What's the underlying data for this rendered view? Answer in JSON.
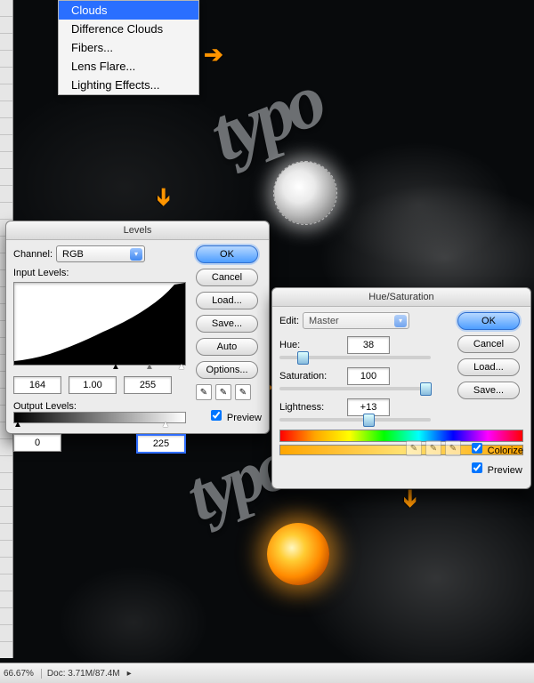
{
  "menu": {
    "items": [
      {
        "label": "Clouds",
        "selected": true
      },
      {
        "label": "Difference Clouds"
      },
      {
        "label": "Fibers..."
      },
      {
        "label": "Lens Flare..."
      },
      {
        "label": "Lighting Effects..."
      }
    ]
  },
  "levels": {
    "title": "Levels",
    "channel_label": "Channel:",
    "channel_value": "RGB",
    "input_label": "Input Levels:",
    "input_black": "164",
    "input_gamma": "1.00",
    "input_white": "255",
    "output_label": "Output Levels:",
    "output_black": "0",
    "output_white": "225",
    "buttons": {
      "ok": "OK",
      "cancel": "Cancel",
      "load": "Load...",
      "save": "Save...",
      "auto": "Auto",
      "options": "Options..."
    },
    "preview_label": "Preview"
  },
  "huesat": {
    "title": "Hue/Saturation",
    "edit_label": "Edit:",
    "edit_value": "Master",
    "hue_label": "Hue:",
    "hue_value": "38",
    "sat_label": "Saturation:",
    "sat_value": "100",
    "light_label": "Lightness:",
    "light_value": "+13",
    "buttons": {
      "ok": "OK",
      "cancel": "Cancel",
      "load": "Load...",
      "save": "Save..."
    },
    "colorize_label": "Colorize",
    "preview_label": "Preview"
  },
  "status": {
    "zoom": "66.67%",
    "doc": "Doc: 3.71M/87.4M"
  },
  "typo_text": "typo"
}
